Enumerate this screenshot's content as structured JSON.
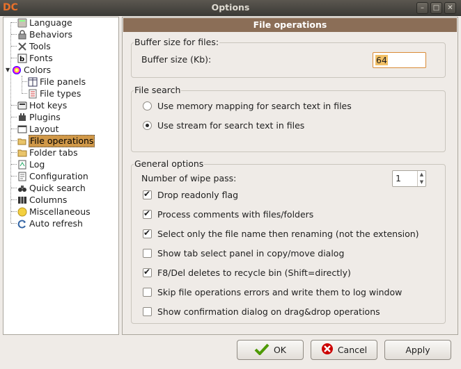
{
  "window": {
    "title": "Options",
    "controls": {
      "minimize": "–",
      "maximize": "□",
      "close": "✕"
    },
    "app_icon_glyph": "DC"
  },
  "sidebar": {
    "items": [
      {
        "label": "Language",
        "icon": "language-icon"
      },
      {
        "label": "Behaviors",
        "icon": "behaviors-icon"
      },
      {
        "label": "Tools",
        "icon": "tools-icon"
      },
      {
        "label": "Fonts",
        "icon": "fonts-icon"
      },
      {
        "label": "Colors",
        "icon": "colors-icon"
      },
      {
        "label": "File panels",
        "icon": "file-panels-icon"
      },
      {
        "label": "File types",
        "icon": "file-types-icon"
      },
      {
        "label": "Hot keys",
        "icon": "hot-keys-icon"
      },
      {
        "label": "Plugins",
        "icon": "plugins-icon"
      },
      {
        "label": "Layout",
        "icon": "layout-icon"
      },
      {
        "label": "File operations",
        "icon": "file-operations-icon",
        "selected": true
      },
      {
        "label": "Folder tabs",
        "icon": "folder-tabs-icon"
      },
      {
        "label": "Log",
        "icon": "log-icon"
      },
      {
        "label": "Configuration",
        "icon": "configuration-icon"
      },
      {
        "label": "Quick search",
        "icon": "quick-search-icon"
      },
      {
        "label": "Columns",
        "icon": "columns-icon"
      },
      {
        "label": "Miscellaneous",
        "icon": "miscellaneous-icon"
      },
      {
        "label": "Auto refresh",
        "icon": "auto-refresh-icon"
      }
    ],
    "selected_color": "#d19949"
  },
  "main": {
    "header": "File operations",
    "header_color": "#8b6e57",
    "buffer": {
      "group_title": "Buffer size for files:",
      "label": "Buffer size (Kb):",
      "value": "64"
    },
    "search": {
      "group_title": "File search",
      "options": [
        {
          "label": "Use memory mapping for search text in files",
          "selected": false
        },
        {
          "label": "Use stream for search text in files",
          "selected": true
        }
      ]
    },
    "general": {
      "group_title": "General options",
      "wipe_label": "Number of wipe pass:",
      "wipe_value": "1",
      "checkboxes": [
        {
          "label": "Drop readonly flag",
          "checked": true
        },
        {
          "label": "Process comments with files/folders",
          "checked": true
        },
        {
          "label": "Select only the file name then renaming (not the extension)",
          "checked": true
        },
        {
          "label": "Show tab select panel in copy/move dialog",
          "checked": false
        },
        {
          "label": "F8/Del deletes to recycle bin (Shift=directly)",
          "checked": true
        },
        {
          "label": "Skip file operations errors and write them to log window",
          "checked": false
        },
        {
          "label": "Show confirmation dialog on drag&drop operations",
          "checked": false
        }
      ]
    }
  },
  "footer": {
    "ok": "OK",
    "cancel": "Cancel",
    "apply": "Apply"
  }
}
